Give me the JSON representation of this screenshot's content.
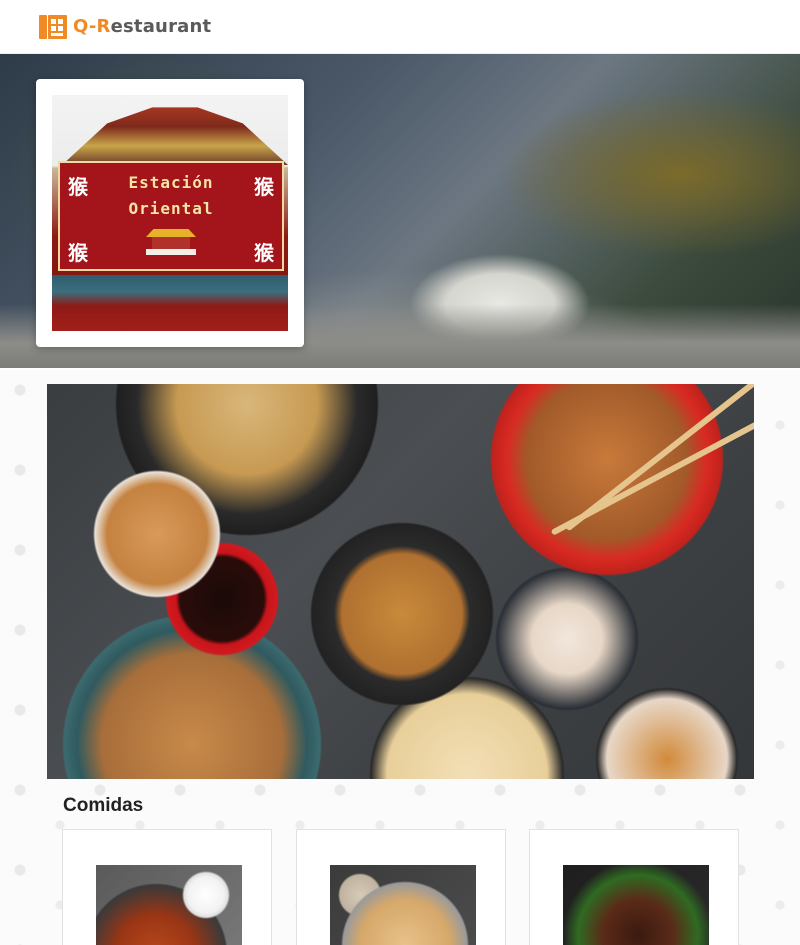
{
  "header": {
    "brand_prefix": "Q-R",
    "brand_suffix": "estaurant",
    "brand_icon": "restaurant-menu-icon",
    "brand_color": "#f08a24"
  },
  "hero": {
    "logo": {
      "line1": "Estación",
      "line2": "Oriental",
      "glyph": "猴"
    }
  },
  "section": {
    "title": "Comidas"
  },
  "cards": [
    {
      "image_alt": "chicken-wings-icon"
    },
    {
      "image_alt": "fried-rice-icon"
    },
    {
      "image_alt": "beef-broccoli-icon"
    }
  ]
}
